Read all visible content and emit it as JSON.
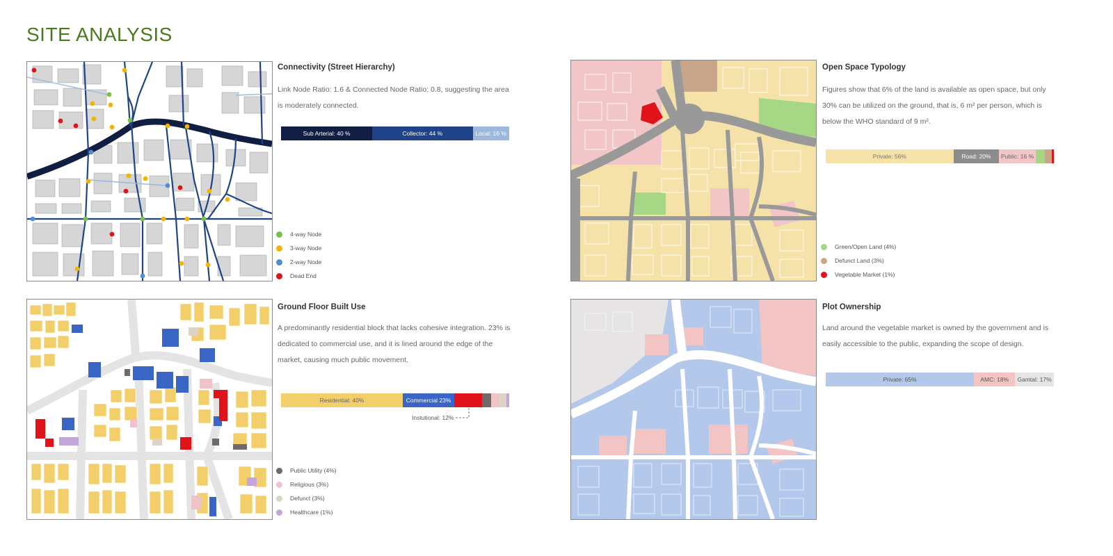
{
  "page": {
    "title": "SITE ANALYSIS"
  },
  "panels": {
    "connectivity": {
      "title": "Connectivity (Street Hierarchy)",
      "description": "Link Node Ratio: 1.6 & Connected Node Ratio: 0.8, suggesting the area is moderately connected.",
      "bar": [
        {
          "label": "Sub Arterial: 40 %",
          "value": 40,
          "color": "#0f1e42",
          "text": "#ffffff"
        },
        {
          "label": "Collector: 44 %",
          "value": 44,
          "color": "#1f4386",
          "text": "#ffffff"
        },
        {
          "label": "Local: 16 %",
          "value": 16,
          "color": "#9cb8de",
          "text": "#ffffff"
        }
      ],
      "legend": [
        {
          "label": "4-way Node",
          "color": "#7bc043"
        },
        {
          "label": "3-way Node",
          "color": "#f2b400"
        },
        {
          "label": "2-way Node",
          "color": "#4f8fd1"
        },
        {
          "label": "Dead End",
          "color": "#e0131a"
        }
      ]
    },
    "open_space": {
      "title": "Open Space Typology",
      "description": "Figures show that 6% of the land is available as open space, but only 30% can be utilized on the ground, that is, 6 m² per person, which is below the WHO standard of 9 m².",
      "bar": [
        {
          "label": "Private: 56%",
          "value": 56,
          "color": "#f5e2a8",
          "text": "#777777"
        },
        {
          "label": "Road: 20%",
          "value": 20,
          "color": "#8c8c8c",
          "text": "#ffffff"
        },
        {
          "label": "Public: 16 %",
          "value": 16,
          "color": "#f2c6c6",
          "text": "#666666"
        },
        {
          "label": "",
          "value": 4,
          "color": "#a6d785",
          "text": "#666666"
        },
        {
          "label": "",
          "value": 3,
          "color": "#c9a58a",
          "text": "#666666"
        },
        {
          "label": "",
          "value": 1,
          "color": "#e0131a",
          "text": "#666666"
        }
      ],
      "legend": [
        {
          "label": "Green/Open Land (4%)",
          "color": "#a6d785"
        },
        {
          "label": "Defunct Land (3%)",
          "color": "#c9a58a"
        },
        {
          "label": "Vegetable Market (1%)",
          "color": "#e0131a"
        }
      ]
    },
    "built_use": {
      "title": "Ground Floor Built Use",
      "description": "A predominantly residential block that lacks cohesive integration. 23% is dedicated to commercial use, and it is lined around the edge of the market, causing much public movement.",
      "bar": [
        {
          "label": "Residential: 40%",
          "value": 40,
          "color": "#f2cf6a",
          "text": "#666666"
        },
        {
          "label": "Commercial 23%",
          "value": 17,
          "color": "#3a65c4",
          "text": "#ffffff"
        },
        {
          "label": "",
          "value": 9,
          "color": "#e0131a",
          "text": "#ffffff"
        },
        {
          "label": "",
          "value": 3,
          "color": "#6f6969",
          "text": "#ffffff"
        },
        {
          "label": "",
          "value": 2.5,
          "color": "#f0c3c8",
          "text": "#ffffff"
        },
        {
          "label": "",
          "value": 2.5,
          "color": "#ddd3c7",
          "text": "#ffffff"
        },
        {
          "label": "",
          "value": 1,
          "color": "#c3a5d9",
          "text": "#ffffff"
        }
      ],
      "note": "Instutional: 12%",
      "legend": [
        {
          "label": "Public Utility (4%)",
          "color": "#6f6969"
        },
        {
          "label": "Religious (3%)",
          "color": "#f0c3c8"
        },
        {
          "label": "Defunct (3%)",
          "color": "#ddd3c7"
        },
        {
          "label": "Healthcare (1%)",
          "color": "#c3a5d9"
        }
      ]
    },
    "ownership": {
      "title": "Plot Ownership",
      "description": "Land around the vegetable market is owned by the government and is easily accessible to the public, expanding the scope of design.",
      "bar": [
        {
          "label": "Private: 65%",
          "value": 65,
          "color": "#b3c8ea",
          "text": "#555555"
        },
        {
          "label": "AMC: 18%",
          "value": 18,
          "color": "#f2c4c4",
          "text": "#555555"
        },
        {
          "label": "Gamtal: 17%",
          "value": 17,
          "color": "#e6e4e4",
          "text": "#555555"
        }
      ]
    }
  }
}
